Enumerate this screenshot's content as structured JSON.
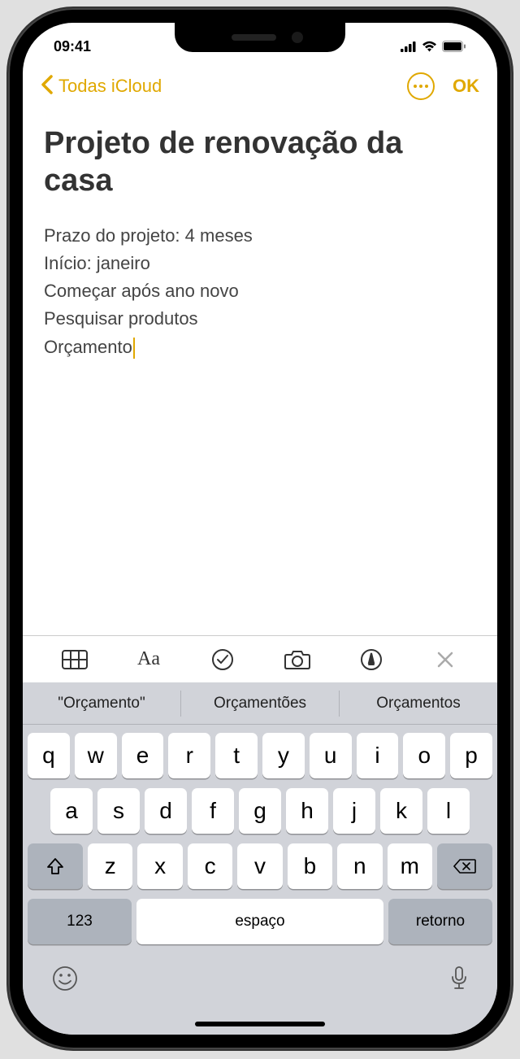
{
  "statusBar": {
    "time": "09:41"
  },
  "nav": {
    "back": "Todas iCloud",
    "done": "OK"
  },
  "note": {
    "title": "Projeto de renovação da casa",
    "lines": [
      "Prazo do projeto: 4 meses",
      "Início: janeiro",
      "Começar após ano novo",
      "Pesquisar produtos",
      "Orçamento"
    ]
  },
  "suggestions": [
    "\"Orçamento\"",
    "Orçamentões",
    "Orçamentos"
  ],
  "keyboard": {
    "row1": [
      "q",
      "w",
      "e",
      "r",
      "t",
      "y",
      "u",
      "i",
      "o",
      "p"
    ],
    "row2": [
      "a",
      "s",
      "d",
      "f",
      "g",
      "h",
      "j",
      "k",
      "l"
    ],
    "row3": [
      "z",
      "x",
      "c",
      "v",
      "b",
      "n",
      "m"
    ],
    "numKey": "123",
    "space": "espaço",
    "return": "retorno"
  }
}
